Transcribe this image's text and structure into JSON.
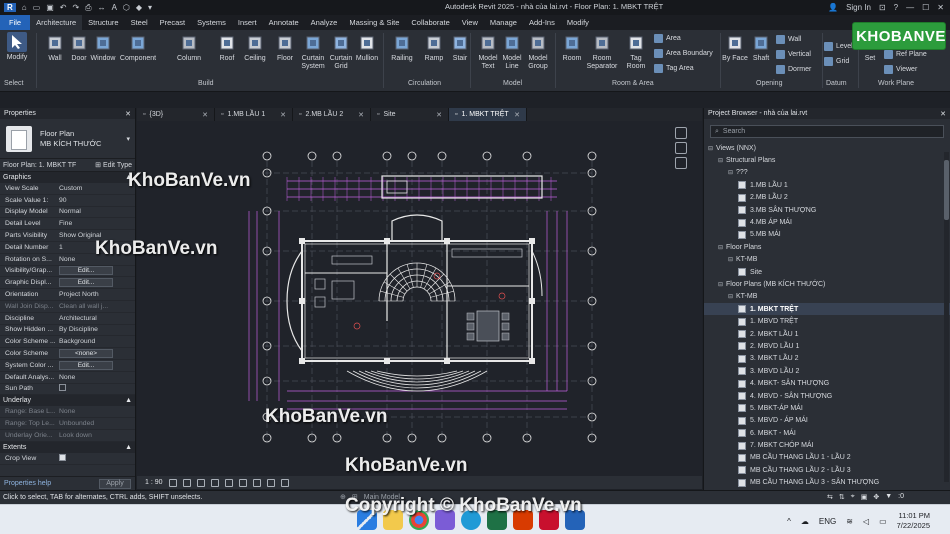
{
  "window": {
    "title": "Autodesk Revit 2025 - nhà của lai.rvt - Floor Plan: 1. MBKT TRỆT",
    "sign_in": "Sign In"
  },
  "ribbon_tabs": [
    "File",
    "Architecture",
    "Structure",
    "Steel",
    "Precast",
    "Systems",
    "Insert",
    "Annotate",
    "Analyze",
    "Massing & Site",
    "Collaborate",
    "View",
    "Manage",
    "Add-Ins",
    "Modify"
  ],
  "active_tab": "Architecture",
  "ribbon": {
    "modify": "Modify",
    "select_panel": "Select",
    "build": [
      "Wall",
      "Door",
      "Window",
      "Component",
      "Column",
      "Roof",
      "Ceiling",
      "Floor",
      "Curtain System",
      "Curtain Grid",
      "Mullion"
    ],
    "build_panel": "Build",
    "circulation": [
      "Railing",
      "Ramp",
      "Stair"
    ],
    "circulation_panel": "Circulation",
    "model": [
      "Model Text",
      "Model Line",
      "Model Group"
    ],
    "model_panel": "Model",
    "room": [
      "Room",
      "Room Separator",
      "Tag Room"
    ],
    "room_small": [
      "Area",
      "Area Boundary",
      "Tag Area"
    ],
    "room_panel": "Room & Area",
    "opening": [
      "By Face",
      "Shaft"
    ],
    "opening_small": [
      "Wall",
      "Vertical",
      "Dormer"
    ],
    "opening_panel": "Opening",
    "datum_small": [
      "Level",
      "Grid"
    ],
    "datum_panel": "Datum",
    "workplane": [
      "Set"
    ],
    "workplane_small": [
      "Show",
      "Ref Plane",
      "Viewer"
    ],
    "workplane_panel": "Work Plane"
  },
  "logo": "KHOBANVE",
  "properties": {
    "header": "Properties",
    "type_name": "Floor Plan",
    "type_sub": "MB KÍCH THƯỚC",
    "instance": "Floor Plan: 1. MBKT TF",
    "edit_type": "Edit Type",
    "graphics_section": "Graphics",
    "rows": [
      {
        "k": "View Scale",
        "v": "Custom"
      },
      {
        "k": "Scale Value 1:",
        "v": "90"
      },
      {
        "k": "Display Model",
        "v": "Normal"
      },
      {
        "k": "Detail Level",
        "v": "Fine"
      },
      {
        "k": "Parts Visibility",
        "v": "Show Original"
      },
      {
        "k": "Detail Number",
        "v": "1"
      },
      {
        "k": "Rotation on S...",
        "v": "None"
      },
      {
        "k": "Visibility/Grap...",
        "v": "Edit..."
      },
      {
        "k": "Graphic Displ...",
        "v": "Edit..."
      },
      {
        "k": "Orientation",
        "v": "Project North"
      },
      {
        "k": "Wall Join Disp...",
        "v": "Clean all wall j..."
      },
      {
        "k": "Discipline",
        "v": "Architectural"
      },
      {
        "k": "Show Hidden ...",
        "v": "By Discipline"
      },
      {
        "k": "Color Scheme ...",
        "v": "Background"
      },
      {
        "k": "Color Scheme",
        "v": "<none>"
      },
      {
        "k": "System Color ...",
        "v": "Edit..."
      },
      {
        "k": "Default Analys...",
        "v": "None"
      },
      {
        "k": "Sun Path",
        "v": ""
      }
    ],
    "underlay_section": "Underlay",
    "underlay_rows": [
      {
        "k": "Range: Base L...",
        "v": "None"
      },
      {
        "k": "Range: Top Le...",
        "v": "Unbounded"
      },
      {
        "k": "Underlay Orie...",
        "v": "Look down"
      }
    ],
    "extents_section": "Extents",
    "extents_rows": [
      {
        "k": "Crop View",
        "v": ""
      }
    ],
    "help": "Properties help",
    "apply": "Apply"
  },
  "doc_tabs": [
    {
      "label": "{3D}",
      "active": false
    },
    {
      "label": "1.MB LẦU 1",
      "active": false
    },
    {
      "label": "2.MB LẦU 2",
      "active": false
    },
    {
      "label": "Site",
      "active": false
    },
    {
      "label": "1. MBKT TRỆT",
      "active": true
    }
  ],
  "view_bar": {
    "scale": "1 : 90"
  },
  "browser": {
    "header": "Project Browser - nhà của lai.rvt",
    "search_placeholder": "Search",
    "nodes": [
      {
        "t": "Views (NNX)",
        "lvl": 0,
        "tg": "▪"
      },
      {
        "t": "Structural Plans",
        "lvl": 1,
        "tg": "▪"
      },
      {
        "t": "???",
        "lvl": 2,
        "tg": "▪"
      },
      {
        "t": "1.MB LẦU 1",
        "lvl": 3,
        "icon": true
      },
      {
        "t": "2.MB LẦU 2",
        "lvl": 3,
        "icon": true
      },
      {
        "t": "3.MB SÂN THƯỢNG",
        "lvl": 3,
        "icon": true
      },
      {
        "t": "4.MB ÁP MÁI",
        "lvl": 3,
        "icon": true
      },
      {
        "t": "5.MB MÁI",
        "lvl": 3,
        "icon": true
      },
      {
        "t": "Floor Plans",
        "lvl": 1,
        "tg": "▪"
      },
      {
        "t": "KT-MB",
        "lvl": 2,
        "tg": "▪"
      },
      {
        "t": "Site",
        "lvl": 3,
        "icon": true
      },
      {
        "t": "Floor Plans (MB KÍCH THƯỚC)",
        "lvl": 1,
        "tg": "▪"
      },
      {
        "t": "KT-MB",
        "lvl": 2,
        "tg": "▪"
      },
      {
        "t": "1. MBKT TRỆT",
        "lvl": 3,
        "icon": true,
        "sel": true
      },
      {
        "t": "1. MBVD TRỆT",
        "lvl": 3,
        "icon": true
      },
      {
        "t": "2. MBKT LẦU 1",
        "lvl": 3,
        "icon": true
      },
      {
        "t": "2. MBVD LẦU 1",
        "lvl": 3,
        "icon": true
      },
      {
        "t": "3. MBKT LẦU 2",
        "lvl": 3,
        "icon": true
      },
      {
        "t": "3. MBVD LẦU 2",
        "lvl": 3,
        "icon": true
      },
      {
        "t": "4. MBKT- SÂN THƯỢNG",
        "lvl": 3,
        "icon": true
      },
      {
        "t": "4. MBVD - SÂN THƯỢNG",
        "lvl": 3,
        "icon": true
      },
      {
        "t": "5. MBKT-ÁP MÁI",
        "lvl": 3,
        "icon": true
      },
      {
        "t": "5. MBVD - ÁP MÁI",
        "lvl": 3,
        "icon": true
      },
      {
        "t": "6. MBKT - MÁI",
        "lvl": 3,
        "icon": true
      },
      {
        "t": "7. MBKT CHÓP MÁI",
        "lvl": 3,
        "icon": true
      },
      {
        "t": "MB CẦU THANG LẦU 1 - LẦU 2",
        "lvl": 3,
        "icon": true
      },
      {
        "t": "MB CẦU THANG LẦU 2 - LẦU 3",
        "lvl": 3,
        "icon": true
      },
      {
        "t": "MB CẦU THANG LẦU 3 - SÂN THƯỢNG",
        "lvl": 3,
        "icon": true
      }
    ]
  },
  "status": {
    "hint": "Click to select, TAB for alternates, CTRL adds, SHIFT unselects.",
    "model": "Main Model",
    "zero": ":0"
  },
  "taskbar": {
    "lang": "ENG",
    "time": "11:01 PM",
    "date": "7/22/2025"
  },
  "watermarks": [
    "KhoBanVe.vn",
    "KhoBanVe.vn",
    "KhoBanVe.vn",
    "KhoBanVe.vn",
    "Copyright © KhoBanVe.vn"
  ],
  "colors": {
    "accent": "#2463b8",
    "cad_magenta": "#c060e0",
    "cad_white": "#e8e8e8",
    "logo_green": "#2c9c3c"
  }
}
